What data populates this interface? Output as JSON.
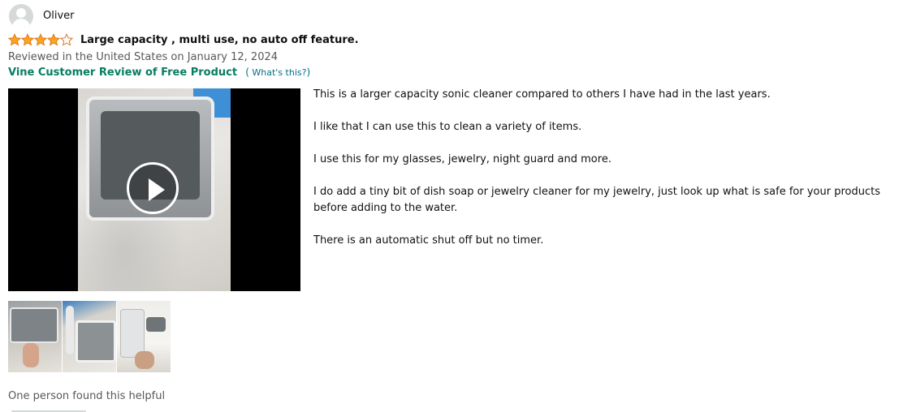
{
  "reviewer": {
    "name": "Oliver"
  },
  "review": {
    "rating": 4,
    "rating_max": 5,
    "title": "Large capacity , multi use, no auto off feature.",
    "date_line": "Reviewed in the United States on January 12, 2024",
    "vine_label": "Vine Customer Review of Free Product",
    "whats_this": "What's this?",
    "paren_open": "(",
    "paren_close": ")",
    "body": [
      "This is a larger capacity sonic cleaner compared to others I have had in the last years.",
      "I like that I can use this to clean a variety of items.",
      "I use this for my glasses, jewelry, night guard and more.",
      "I do add a tiny bit of dish soap or jewelry cleaner for my jewelry, just look up what is safe for your products before adding to the water.",
      "There is an automatic shut off but no timer."
    ],
    "helpful_text": "One person found this helpful"
  },
  "media": {
    "video_icon": "play-icon",
    "thumbnails": [
      "review-image-1",
      "review-image-2",
      "review-image-3"
    ]
  },
  "colors": {
    "star": "#ffa41c",
    "vine": "#067d62",
    "link": "#007185",
    "muted": "#565959"
  }
}
